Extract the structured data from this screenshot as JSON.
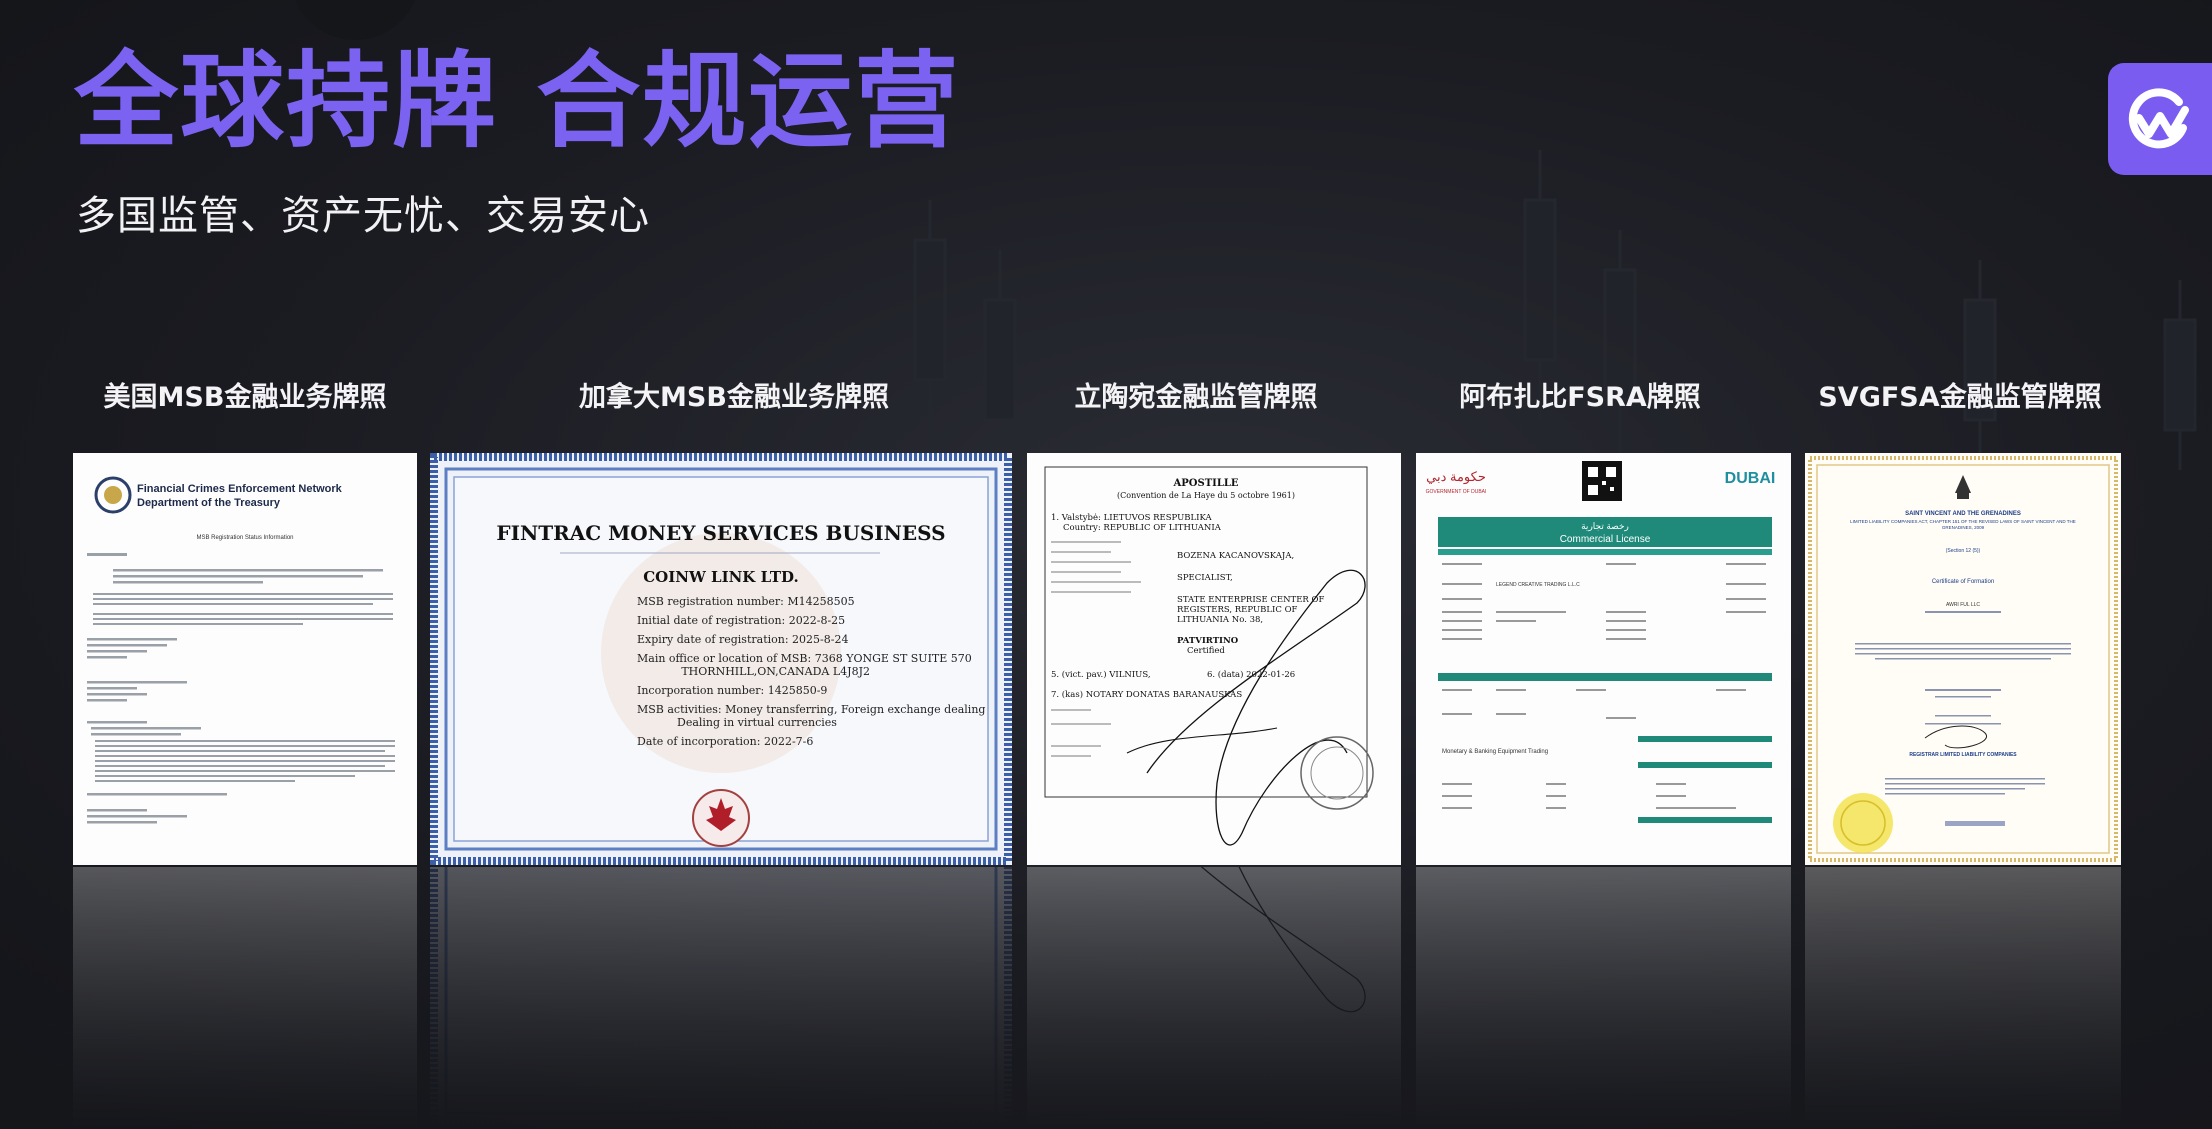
{
  "header": {
    "title": "全球持牌 合规运营",
    "subtitle": "多国监管、资产无忧、交易安心"
  },
  "brand": {
    "logo_icon": "coin-swap-logo-icon",
    "accent": "#7a5cf0"
  },
  "licenses": [
    {
      "label": "美国MSB金融业务牌照",
      "org_line1": "Financial Crimes Enforcement Network",
      "org_line2": "Department of the Treasury",
      "doc_title": "MSB Registration Status Information"
    },
    {
      "label": "加拿大MSB金融业务牌照",
      "heading": "FINTRAC MONEY SERVICES BUSINESS",
      "company": "COINW LINK LTD.",
      "msb_number": "MSB registration number: M14258505",
      "initial_date": "Initial date of registration: 2022-8-25",
      "expiry_date": "Expiry date of registration: 2025-8-24",
      "main_office": "Main office or location of MSB: 7368 YONGE ST SUITE 570",
      "main_office_2": "THORNHILL,ON,CANADA L4J8J2",
      "incorporation_number": "Incorporation number: 1425850-9",
      "activities": "MSB activities: Money transferring, Foreign exchange dealing",
      "activities_2": "Dealing in virtual currencies",
      "incorporation_date": "Date of incorporation: 2022-7-6"
    },
    {
      "label": "立陶宛金融监管牌照",
      "heading": "APOSTILLE",
      "convention": "(Convention de La Haye du 5 octobre 1961)",
      "line1": "1. Valstybė: LIETUVOS RESPUBLIKA",
      "line1b": "Country: REPUBLIC OF LITHUANIA",
      "signer": "BOZENA KACANOVSKAJA,",
      "role": "SPECIALIST,",
      "center": "STATE ENTERPRISE CENTER OF",
      "center2": "REGISTERS, REPUBLIC OF",
      "center3": "LITHUANIA No. 38,",
      "certified": "PATVIRTINO",
      "certified2": "Certified",
      "place": "5. (vict. pav.) VILNIUS,",
      "date": "6. (data) 2022-01-26",
      "notary": "7. (kas) NOTARY DONATAS BARANAUSKAS"
    },
    {
      "label": "阿布扎比FSRA牌照",
      "gov_left": "GOVERNMENT OF DUBAI",
      "brand_right": "DUBAI",
      "arabic_title": "رخصة تجارية",
      "heading": "Commercial License",
      "company": "LEGEND CREATIVE TRADING L.L.C",
      "activity": "Monetary & Banking Equipment Trading"
    },
    {
      "label": "SVGFSA金融监管牌照",
      "heading": "SAINT VINCENT AND THE GRENADINES",
      "act": "LIMITED LIABILITY COMPANIES ACT, CHAPTER 151 OF THE REVISED LAWS OF SAINT VINCENT AND THE GRENADINES, 2009",
      "section": "(Section 12 (5))",
      "cert_title": "Certificate of Formation",
      "company": "AWRI FUL LLC",
      "registrar": "REGISTRAR LIMITED LIABILITY COMPANIES"
    }
  ]
}
